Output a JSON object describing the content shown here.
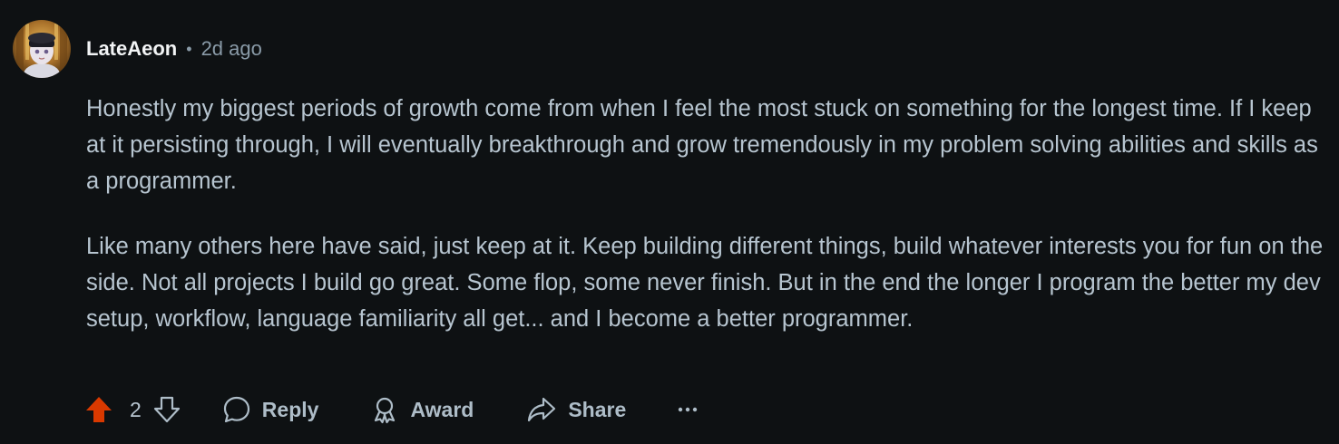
{
  "comment": {
    "author": "LateAeon",
    "separator": "•",
    "time": "2d ago",
    "paragraphs": [
      "Honestly my biggest periods of growth come from when I feel the most stuck on something for the longest time. If I keep at it persisting through, I will eventually breakthrough and grow tremendously in my problem solving abilities and skills as a programmer.",
      "Like many others here have said, just keep at it. Keep building different things, build whatever interests you for fun on the side. Not all projects I build go great. Some flop, some never finish. But in the end the longer I program the better my dev setup, workflow, language familiarity all get... and I become a better programmer."
    ]
  },
  "actions": {
    "vote_count": "2",
    "upvote_state": "upvoted",
    "reply_label": "Reply",
    "award_label": "Award",
    "share_label": "Share",
    "more_label": "···"
  },
  "icons": {
    "avatar": "user-avatar",
    "upvote": "upvote-arrow-icon",
    "downvote": "downvote-arrow-icon",
    "reply": "speech-bubble-icon",
    "award": "award-ribbon-icon",
    "share": "share-arrow-icon",
    "more": "ellipsis-icon"
  },
  "colors": {
    "background": "#0e1113",
    "upvote_active": "#d93900",
    "text": "#b7c5d0",
    "author": "#f2f4f5",
    "meta": "#8a9ba8"
  }
}
